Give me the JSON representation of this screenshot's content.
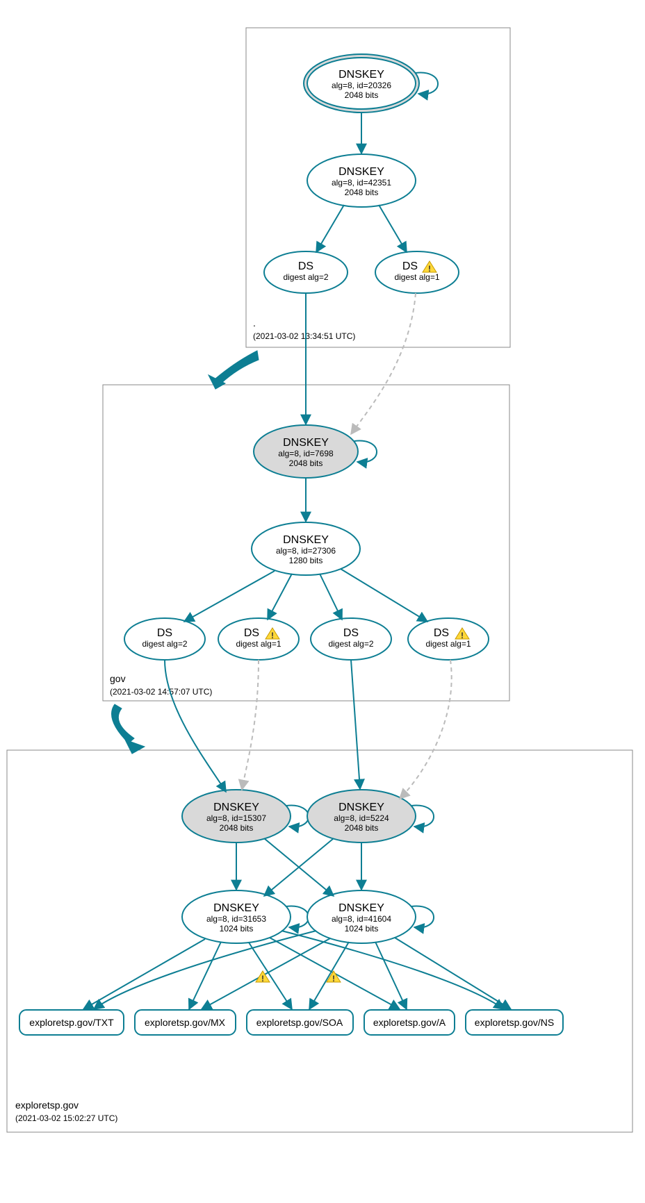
{
  "colors": {
    "stroke": "#0d7e93",
    "fill_grey": "#d9d9d9",
    "warn": "#ffd83a"
  },
  "zones": {
    "root": {
      "name": ".",
      "timestamp": "(2021-03-02 13:34:51 UTC)"
    },
    "gov": {
      "name": "gov",
      "timestamp": "(2021-03-02 14:57:07 UTC)"
    },
    "domain": {
      "name": "exploretsp.gov",
      "timestamp": "(2021-03-02 15:02:27 UTC)"
    }
  },
  "nodes": {
    "root_ksk": {
      "title": "DNSKEY",
      "line1": "alg=8, id=20326",
      "line2": "2048 bits"
    },
    "root_zsk": {
      "title": "DNSKEY",
      "line1": "alg=8, id=42351",
      "line2": "2048 bits"
    },
    "root_ds1": {
      "title": "DS",
      "line1": "digest alg=2"
    },
    "root_ds2": {
      "title": "DS",
      "line1": "digest alg=1",
      "warn": true
    },
    "gov_ksk": {
      "title": "DNSKEY",
      "line1": "alg=8, id=7698",
      "line2": "2048 bits"
    },
    "gov_zsk": {
      "title": "DNSKEY",
      "line1": "alg=8, id=27306",
      "line2": "1280 bits"
    },
    "gov_ds1": {
      "title": "DS",
      "line1": "digest alg=2"
    },
    "gov_ds2": {
      "title": "DS",
      "line1": "digest alg=1",
      "warn": true
    },
    "gov_ds3": {
      "title": "DS",
      "line1": "digest alg=2"
    },
    "gov_ds4": {
      "title": "DS",
      "line1": "digest alg=1",
      "warn": true
    },
    "dom_ksk1": {
      "title": "DNSKEY",
      "line1": "alg=8, id=15307",
      "line2": "2048 bits"
    },
    "dom_ksk2": {
      "title": "DNSKEY",
      "line1": "alg=8, id=5224",
      "line2": "2048 bits"
    },
    "dom_zsk1": {
      "title": "DNSKEY",
      "line1": "alg=8, id=31653",
      "line2": "1024 bits"
    },
    "dom_zsk2": {
      "title": "DNSKEY",
      "line1": "alg=8, id=41604",
      "line2": "1024 bits"
    },
    "rr_txt": {
      "label": "exploretsp.gov/TXT"
    },
    "rr_mx": {
      "label": "exploretsp.gov/MX"
    },
    "rr_soa": {
      "label": "exploretsp.gov/SOA"
    },
    "rr_a": {
      "label": "exploretsp.gov/A"
    },
    "rr_ns": {
      "label": "exploretsp.gov/NS"
    }
  }
}
